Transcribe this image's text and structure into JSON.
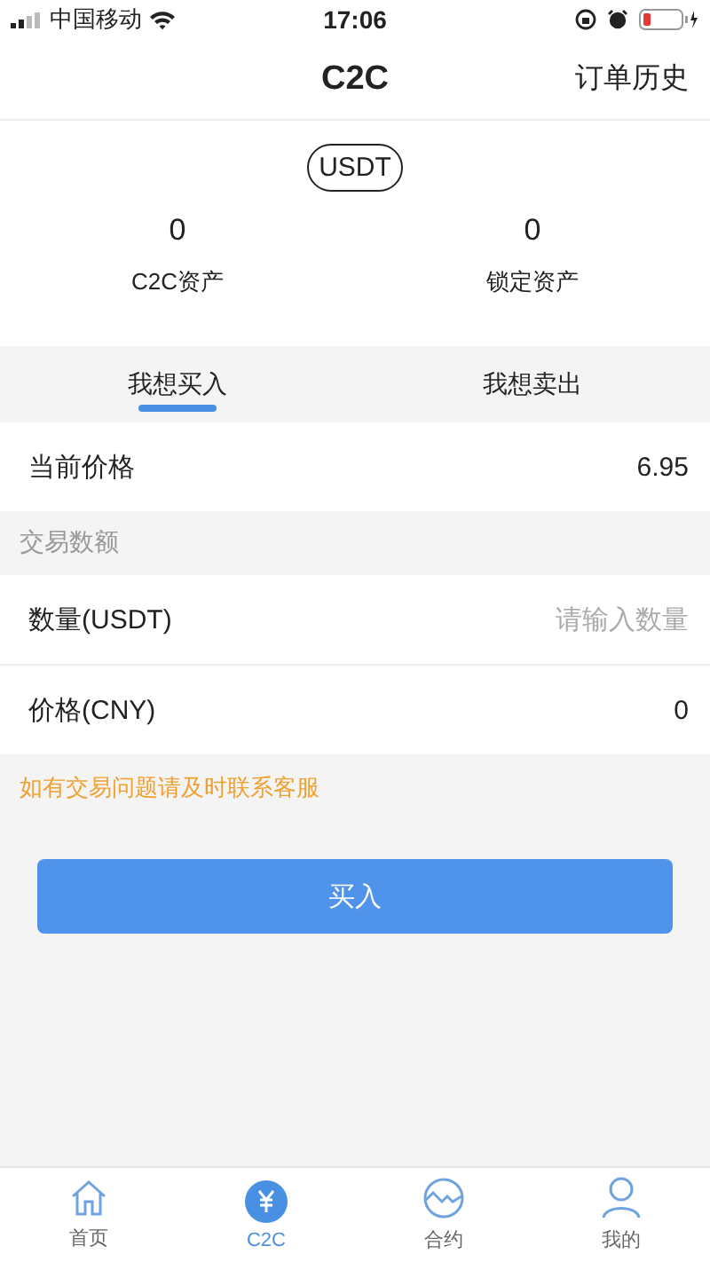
{
  "status_bar": {
    "carrier": "中国移动",
    "time": "17:06"
  },
  "header": {
    "title": "C2C",
    "action": "订单历史"
  },
  "currency": "USDT",
  "assets": [
    {
      "value": "0",
      "label": "C2C资产"
    },
    {
      "value": "0",
      "label": "锁定资产"
    }
  ],
  "tabs": [
    {
      "label": "我想买入",
      "selected": true
    },
    {
      "label": "我想卖出",
      "selected": false
    }
  ],
  "current_price": {
    "label": "当前价格",
    "value": "6.95"
  },
  "section_label": "交易数额",
  "fields": [
    {
      "label": "数量(USDT)",
      "placeholder": "请输入数量"
    },
    {
      "label": "价格(CNY)",
      "value": "0"
    }
  ],
  "hint": "如有交易问题请及时联系客服",
  "submit_button": "买入",
  "bottom_nav": [
    {
      "label": "首页",
      "kind": "home",
      "selected": false
    },
    {
      "label": "C2C",
      "kind": "yuan",
      "selected": true
    },
    {
      "label": "合约",
      "kind": "wave",
      "selected": false
    },
    {
      "label": "我的",
      "kind": "person",
      "selected": false
    }
  ]
}
